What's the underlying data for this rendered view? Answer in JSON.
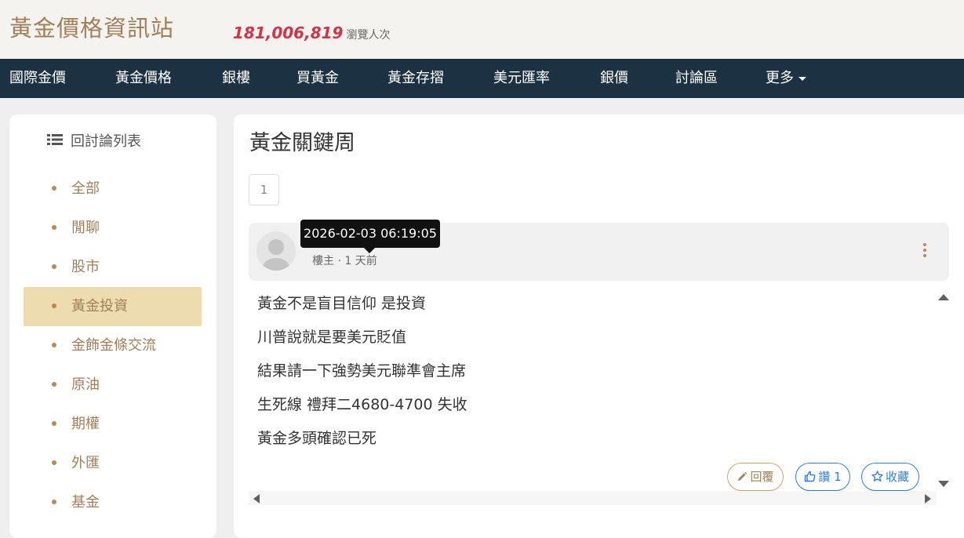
{
  "header": {
    "site_title": "黃金價格資訊站",
    "view_count": "181,006,819",
    "view_label": "瀏覽人次"
  },
  "nav": {
    "items": [
      "國際金價",
      "黃金價格",
      "銀樓",
      "買黃金",
      "黃金存摺",
      "美元匯率",
      "銀價",
      "討論區"
    ],
    "more_label": "更多"
  },
  "sidebar": {
    "header": "回討論列表",
    "items": [
      "全部",
      "閒聊",
      "股市",
      "黃金投資",
      "金飾金條交流",
      "原油",
      "期權",
      "外匯",
      "基金"
    ],
    "active_index": 3
  },
  "thread": {
    "title": "黃金關鍵周",
    "page_number": "1"
  },
  "post": {
    "author_role": "樓主",
    "separator": "·",
    "time_ago": "1 天前",
    "tooltip": "2026-02-03 06:19:05",
    "lines": [
      "黃金不是盲目信仰 是投資",
      "川普說就是要美元貶值",
      "結果請一下強勢美元聯準會主席",
      "生死線 禮拜二4680-4700 失收",
      "黃金多頭確認已死"
    ],
    "actions": {
      "reply_label": "回覆",
      "like_label": "讚 1",
      "favorite_label": "收藏"
    }
  },
  "colors": {
    "nav_background": "#1c3242",
    "brand_gold": "#a0805a",
    "active_item_background": "#ecdcb0",
    "view_count_red": "#d0344b",
    "like_blue": "#2f7fd6"
  },
  "icons": [
    "list-icon",
    "caret-down-icon",
    "avatar-placeholder-icon",
    "more-vertical-icon",
    "pencil-icon",
    "thumbs-up-icon",
    "star-icon",
    "scroll-up-arrow-icon",
    "scroll-down-arrow-icon",
    "scroll-left-arrow-icon",
    "scroll-right-arrow-icon"
  ]
}
